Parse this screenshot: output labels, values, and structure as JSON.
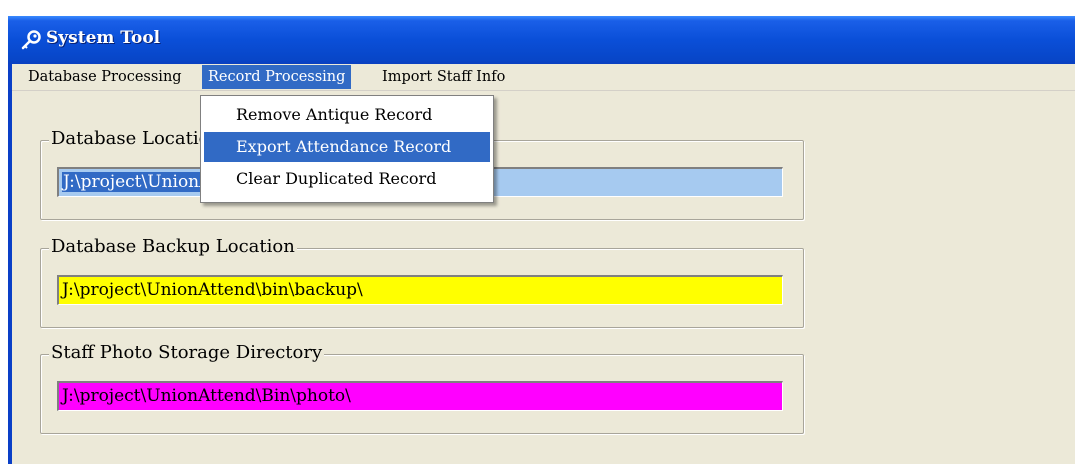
{
  "window": {
    "title": "System Tool",
    "title_icon": "key-icon"
  },
  "menubar": {
    "items": [
      {
        "label": "Database Processing"
      },
      {
        "label": "Record Processing"
      },
      {
        "label": "Import Staff Info"
      }
    ]
  },
  "dropdown": {
    "items": [
      {
        "label": "Remove Antique Record"
      },
      {
        "label": "Export Attendance Record"
      },
      {
        "label": "Clear Duplicated Record"
      }
    ]
  },
  "groups": [
    {
      "label": "Database Location",
      "value": "J:\\project\\UnionAttend\\bin\\",
      "color": "#a6caf0"
    },
    {
      "label": "Database Backup Location",
      "value": "J:\\project\\UnionAttend\\bin\\backup\\",
      "color": "#ffff00"
    },
    {
      "label": "Staff Photo Storage Directory",
      "value": "J:\\project\\UnionAttend\\Bin\\photo\\",
      "color": "#ff00ff"
    }
  ],
  "colors": {
    "titlebar": "#0a4fd8",
    "menu_highlight": "#316ac5",
    "background": "#ece9d8"
  }
}
